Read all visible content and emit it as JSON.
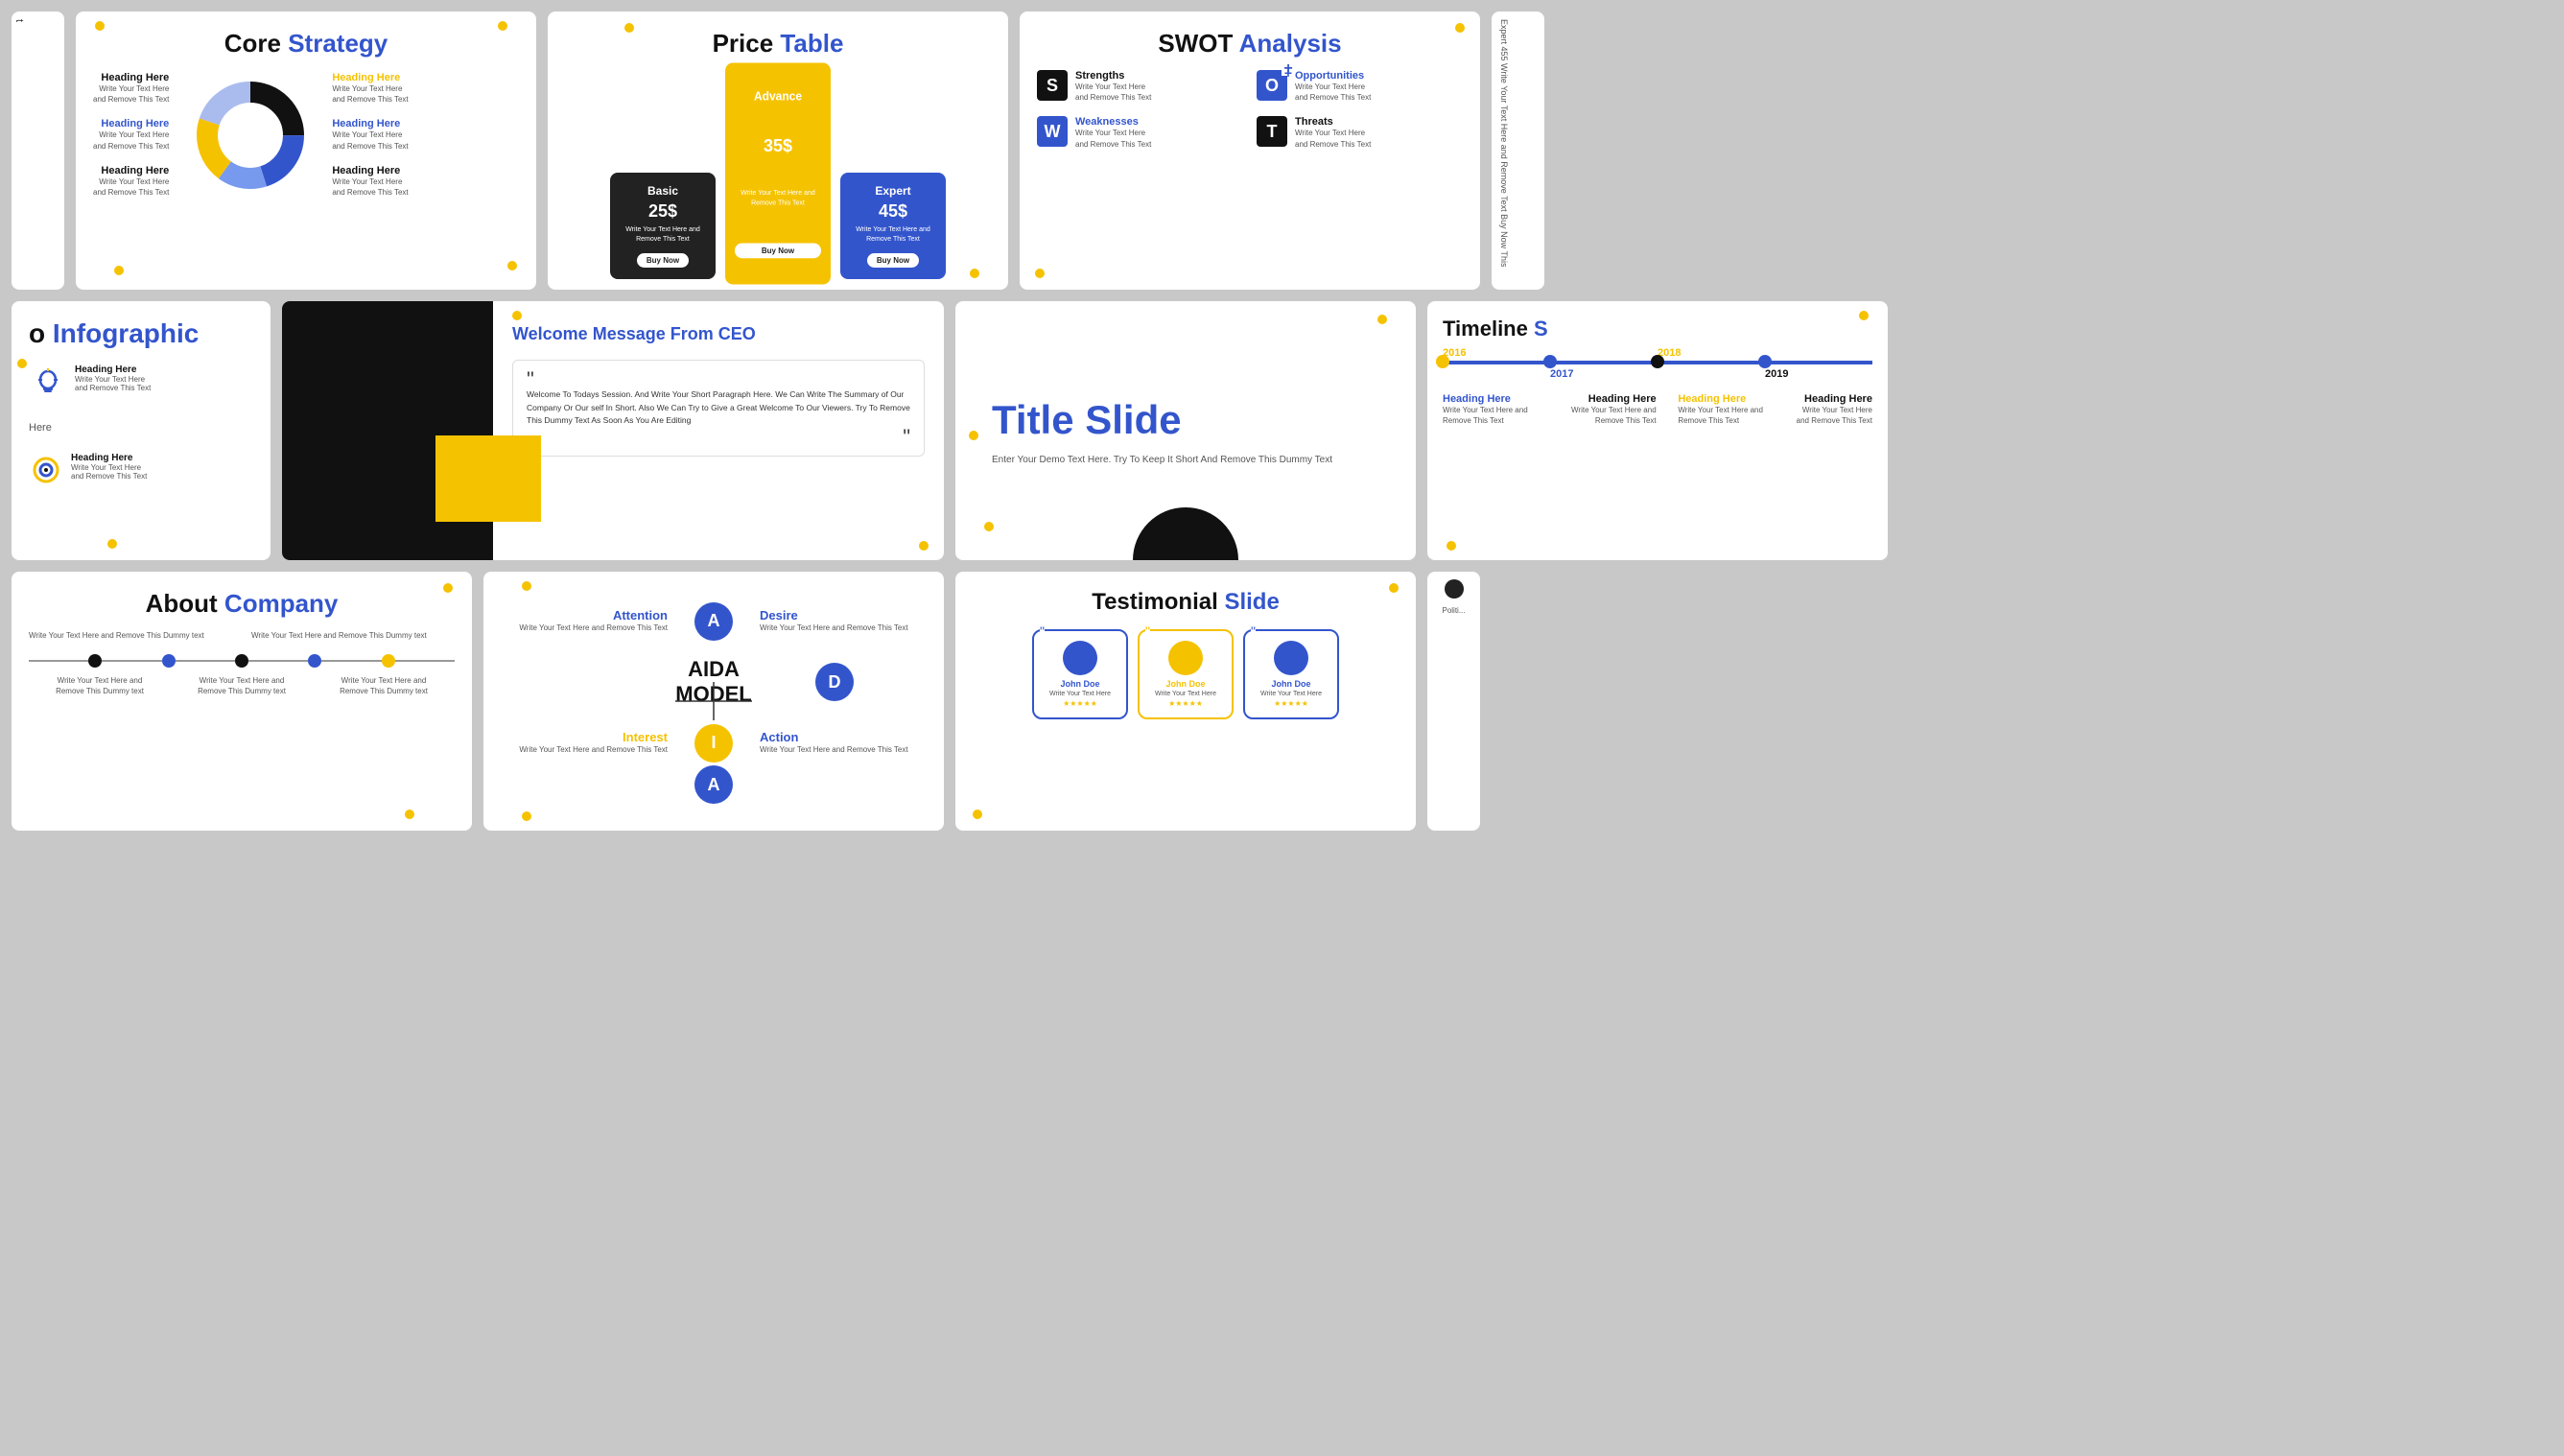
{
  "bg": "#c8c8c8",
  "slides": {
    "core_strategy": {
      "title_black": "Core ",
      "title_blue": "Strategy",
      "headings": [
        {
          "label": "Heading Here",
          "color": "black",
          "text": "Write Your Text Here and Remove This Text"
        },
        {
          "label": "Heading Here",
          "color": "blue",
          "text": "Write Your Text Here and Remove This Text"
        },
        {
          "label": "Heading Here",
          "color": "black",
          "text": "Write Your Text Here and Remove This Text"
        }
      ],
      "headings_right": [
        {
          "label": "Heading Here",
          "color": "yellow",
          "text": "Write Your Text Here and Remove This Text"
        },
        {
          "label": "Heading Here",
          "color": "blue",
          "text": "Write Your Text Here and Remove This Text"
        },
        {
          "label": "Heading Here",
          "color": "black",
          "text": "Write Your Text Here and Remove This Text"
        }
      ],
      "donut_segments": [
        {
          "color": "#111",
          "pct": 25
        },
        {
          "color": "#3355cc",
          "pct": 20
        },
        {
          "color": "#6677dd",
          "pct": 15
        },
        {
          "color": "#f5c200",
          "pct": 20
        },
        {
          "color": "#aabbee",
          "pct": 20
        }
      ]
    },
    "price_table": {
      "title_black": "Price ",
      "title_blue": "Table",
      "cards": [
        {
          "name": "Basic",
          "price": "25$",
          "text": "Write Your Text Here and Remove This Text",
          "btn": "Buy Now",
          "type": "basic"
        },
        {
          "name": "Advance",
          "price": "35$",
          "text": "Write Your Text Here and Remove This Text",
          "btn": "Buy Now",
          "type": "advance"
        },
        {
          "name": "Expert",
          "price": "45$",
          "text": "Write Your Text Here and Remove This Text",
          "btn": "Buy Now",
          "type": "expert"
        }
      ]
    },
    "swot": {
      "title_black": "SWOT ",
      "title_blue": "Analysis",
      "items": [
        {
          "letter": "S",
          "label": "Strengths",
          "text": "Write Your Text Here and Remove This Text",
          "style": "swot-s"
        },
        {
          "letter": "O",
          "label": "Opportunities",
          "text": "Write Your Text Here and Remove This Text",
          "style": "swot-o"
        },
        {
          "letter": "W",
          "label": "Weaknesses",
          "text": "Write Your Text Here and Remove This Text",
          "style": "swot-w"
        },
        {
          "letter": "T",
          "label": "Threats",
          "text": "Write Your Text Here and Remove This Text",
          "style": "swot-t"
        }
      ]
    },
    "ceo": {
      "title": "Welcome Message From CEO",
      "quote": "Welcome To Todays Session. And Write Your Short Paragraph Here. We Can Write The Summary of Our Company Or Our self In Short. Also We Can Try to Give a Great Welcome To Our Viewers. Try To Remove This Dummy Text As Soon As You Are Editing"
    },
    "title_slide": {
      "heading": "Title Slide",
      "sub": "Enter Your Demo Text Here. Try To Keep It Short And Remove This Dummy Text"
    },
    "timeline": {
      "title_black": "Timeline ",
      "title_blue": "S",
      "years": [
        "2016",
        "2017",
        "2018",
        "2019"
      ],
      "headings": [
        {
          "label": "Heading Here",
          "color": "blue",
          "text": "Write Your Text Here and Remove This Text"
        },
        {
          "label": "Heading Here",
          "color": "black",
          "text": "Write Your Text Here and Remove This Text"
        },
        {
          "label": "Heading Here",
          "color": "yellow",
          "text": "Write Your Text Here and Remove This Text"
        },
        {
          "label": "Heading Here",
          "color": "black",
          "text": "Write Your Text Here and Remove This Text"
        }
      ]
    },
    "infographic": {
      "title_black": "o Infographic",
      "items": [
        {
          "label": "Heading Here",
          "text": "Write Your Text Here and Remove This Text"
        },
        {
          "label": "Heading Here",
          "text": "Write Your Text Here and Remove This Text"
        }
      ]
    },
    "about": {
      "title_black": "About ",
      "title_blue": "Company",
      "text_items": [
        "Write Your Text Here and Remove This Dummy text",
        "Write Your Text Here and Remove This Dummy text",
        "Write Your Text Here and Remove This Dummy text",
        "Write Your Text Here and Remove This Dummy text",
        "Write Your Text Here and Remove This Dummy text"
      ]
    },
    "aida": {
      "center": "AIDA\nMODEL",
      "items": [
        {
          "label": "Attention",
          "letter": "A",
          "text": "Write Your Text Here and Remove This Text",
          "color": "#3355cc",
          "pos": "tl"
        },
        {
          "label": "Desire",
          "letter": "D",
          "text": "Write Your Text Here and Remove This Text",
          "color": "#3355cc",
          "pos": "tr"
        },
        {
          "label": "Interest",
          "letter": "I",
          "text": "Write Your Text Here and Remove This Text",
          "color": "#f5c200",
          "pos": "bl"
        },
        {
          "label": "Action",
          "letter": "A",
          "text": "Write Your Text Here and Remove This Text",
          "color": "#3355cc",
          "pos": "br"
        }
      ]
    },
    "testimonial": {
      "title_black": "Testimonial ",
      "title_blue": "Slide",
      "cards": [
        {
          "name": "John Doe",
          "text": "Write Your Text Here",
          "stars": "★★★★★",
          "type": "blue"
        },
        {
          "name": "John Doe",
          "text": "Write Your Text Here",
          "stars": "★★★★★",
          "type": "yellow"
        },
        {
          "name": "John Doe",
          "text": "Write Your Text Here",
          "stars": "★★★★★",
          "type": "blue"
        }
      ]
    },
    "partial_right1": {
      "label": "t",
      "text": "Expert 455 Write Your Text Here and Remove Text Buy Now This"
    },
    "partial_right3": {
      "label": "Politi..."
    }
  }
}
